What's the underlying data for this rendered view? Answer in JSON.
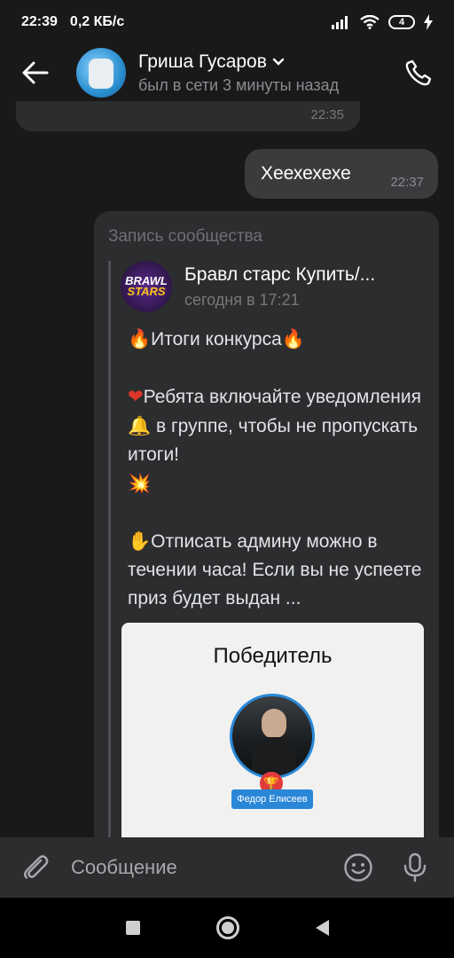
{
  "status_bar": {
    "time": "22:39",
    "net_speed": "0,2 КБ/с",
    "battery": "4"
  },
  "header": {
    "name": "Гриша Гусаров",
    "status": "был в сети 3 минуты назад"
  },
  "messages": {
    "prev_time": "22:35",
    "outgoing": {
      "text": "Хеехехехе",
      "time": "22:37"
    }
  },
  "repost": {
    "label": "Запись сообщества",
    "group_avatar_line1": "BRAWL",
    "group_avatar_line2": "STARS",
    "group_name": "Бравл старс Купить/...",
    "date": "сегодня в 17:21",
    "line1_emoji_a": "🔥",
    "line1_text": "Итоги конкурса",
    "line1_emoji_b": "🔥",
    "line2_emoji": "❤",
    "line2_text_a": "Ребята включайте уведомления",
    "line2_emoji_bell": "🔔",
    "line2_text_b": " в группе, чтобы не пропускать итоги!",
    "line2_emoji_boom": "💥",
    "line3_emoji": "✋",
    "line3_text": "Отписать админу можно в течении часа! Если вы не успеете приз будет выдан ...",
    "image": {
      "title": "Победитель",
      "trophy": "🏆",
      "winner_name": "Федор Елисеев"
    }
  },
  "composer": {
    "placeholder": "Сообщение"
  },
  "colors": {
    "background": "#19191a",
    "bubble": "#2c2d2e",
    "accent": "#2a87d8"
  }
}
